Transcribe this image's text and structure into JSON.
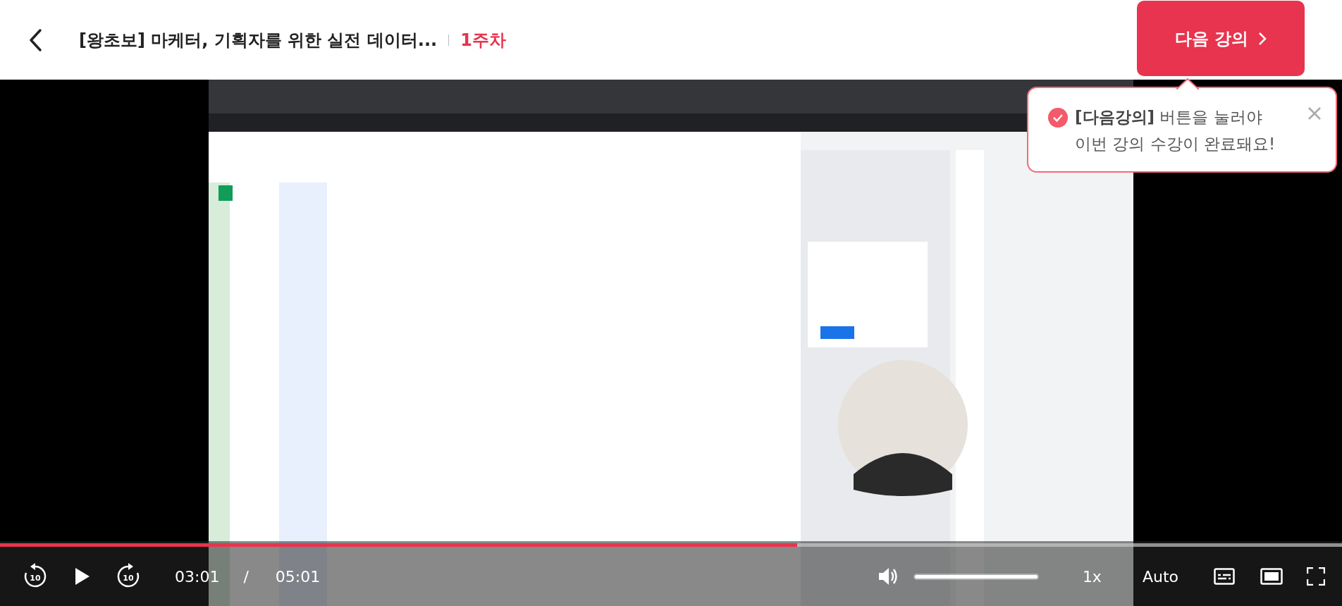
{
  "header": {
    "title": "[왕초보] 마케터, 기획자를 위한 실전 데이터...",
    "week": "1주차",
    "next_button": "다음 강의"
  },
  "tooltip": {
    "lines": [
      "**[다음강의]** 버튼을 눌러야",
      "이번 강의 수강이 완료돼요!"
    ]
  },
  "player": {
    "progress": {
      "level": 0.594
    },
    "rewind_label": "10",
    "forward_label": "10",
    "playing": false,
    "current_time": "03:01",
    "separator": "/",
    "duration": "05:01",
    "volume": {
      "level": 1
    },
    "speed": "1x",
    "quality": "Auto"
  }
}
